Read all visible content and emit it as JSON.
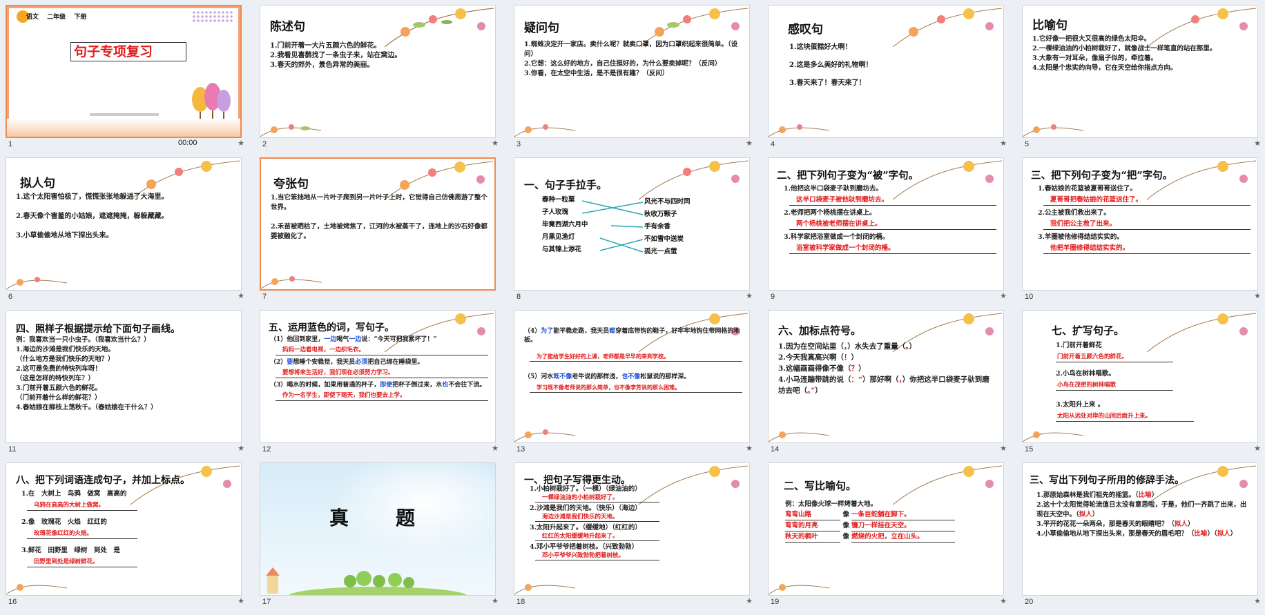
{
  "slides": [
    {
      "num": "1",
      "time": "00:00",
      "header": {
        "subject": "语文",
        "grade": "二年级",
        "term": "下册"
      },
      "title": "句子专项复习"
    },
    {
      "num": "2",
      "title": "陈述句",
      "lines": [
        "1.门前开着一大片五颜六色的鲜花。",
        "2.我看见喜鹊找了一条虫子来，站在窝边。",
        "3.春天的郊外，景色异常的美丽。"
      ]
    },
    {
      "num": "3",
      "title": "疑问句",
      "lines": [
        "1.蜘蛛决定开一家店。卖什么呢？就卖口罩，因为口罩织起来很简单。（设问）",
        "2.它想：这么好的地方，自己住挺好的，为什么要卖掉呢？（反问）",
        "3.你看，在太空中生活，是不是很有趣？（反问）"
      ]
    },
    {
      "num": "4",
      "title": "感叹句",
      "lines": [
        "1.这块蛋糕好大啊！",
        "2.这是多么美好的礼物啊！",
        "3.春天来了！春天来了！"
      ]
    },
    {
      "num": "5",
      "title": "比喻句",
      "lines": [
        "1.它好像一把很大又很高的绿色太阳伞。",
        "2.一棵绿油油的小柏树栽好了，就像战士一样笔直的站在那里。",
        "3.大象有一对耳朵，像扇子似的，牵拉着。",
        "4.太阳是个忠实的向导，它在天空给你指点方向。"
      ]
    },
    {
      "num": "6",
      "title": "拟人句",
      "lines": [
        "1.这个太阳害怕极了，慌慌张张地躲进了大海里。",
        "2.春天像个害羞的小姑娘，遮遮掩掩，躲躲藏藏。",
        "3.小草偷偷地从地下探出头来。"
      ]
    },
    {
      "num": "7",
      "title": "夸张句",
      "lines": [
        "1.当它笨拙地从一片叶子爬到另一片叶子上时，它觉得自己仿佛周游了整个世界。",
        "2.禾苗被晒枯了，土地被烤焦了，江河的水被蒸干了，连地上的沙石好像都要被融化了。"
      ]
    },
    {
      "num": "8",
      "title": "一、句子手拉手。",
      "left": [
        "春种一粒粟",
        "子人玫瑰",
        "毕竟西湖六月中",
        "月黑见渔灯",
        "与其锦上添花"
      ],
      "right": [
        "风光不与四时同",
        "秋收万颗子",
        "手有余香",
        "不如雪中送炭",
        "孤光一点萤"
      ]
    },
    {
      "num": "9",
      "title": "二、把下列句子变为“被”字句。",
      "items": [
        {
          "q": "1.他把这半口袋麦子驮到磨坊去。",
          "a": "这半口袋麦子被他驮到磨坊去。"
        },
        {
          "q": "2.老师把两个杨桃摆在讲桌上。",
          "a": "两个杨桃被老师摆在讲桌上。"
        },
        {
          "q": "3.科学家把浴室做成一个封闭的桶。",
          "a": "浴室被科学家做成一个封闭的桶。"
        }
      ]
    },
    {
      "num": "10",
      "title": "三、把下列句子变为“把”字句。",
      "items": [
        {
          "q": "1.春姑娘的花篮被夏哥哥送住了。",
          "a": "夏哥哥把春姑娘的花篮送住了。"
        },
        {
          "q": "2.公主被我们救出来了。",
          "a": "我们把公主救了出来。"
        },
        {
          "q": "3.羊圈被他修得结结实实的。",
          "a": "他把羊圈修得结结实实的。"
        }
      ]
    },
    {
      "num": "11",
      "title": "四、照样子根据提示给下面句子画线。",
      "lines": [
        "例：我喜欢当一只小虫子。（我喜欢当什么？）",
        "1.海边的沙滩是我们快乐的天地。",
        "（什么地方是我们快乐的天地？）",
        "2.这可是免费的特快列车呀！",
        "（这是怎样的特快列车？）",
        "3.门前开着五颜六色的鲜花。",
        "（门前开着什么样的鲜花？）",
        "4.春姑娘在柳枝上荡秋千。（春姑娘在干什么？）"
      ]
    },
    {
      "num": "12",
      "title": "五、运用蓝色的词，写句子。",
      "items": [
        {
          "q1": "（1）他回到家里，",
          "b1": "一边",
          "q2": "喝气",
          "b2": "一边",
          "q3": "说：“今天可把我累坏了！”",
          "a": "妈妈一边看电视，一边织毛衣。"
        },
        {
          "q1": "（2）",
          "b1": "要",
          "q2": "想睡个安稳觉，我天员",
          "b2": "必须",
          "q3": "把自己绑在睡袋里。",
          "a": "要想将来生活好，我们现在必须努力学习。"
        },
        {
          "q1": "（3）喝水的时候，如果用普通的杯子，",
          "b1": "即使",
          "q2": "把杯子倒过来，水",
          "b2": "也",
          "q3": "不会往下流。",
          "a": "作为一名学生，即使下雨天，我们也要去上学。"
        }
      ]
    },
    {
      "num": "13",
      "items": [
        {
          "q1": "（4）",
          "b1": "为了",
          "q2": "能平稳走路，我天员",
          "b2": "都",
          "q3": "穿着底带钩的鞋子，好牢牢地钩住带网格的地板。",
          "a": "为了能给学生好好的上课，老师都是早早的来到学校。"
        },
        {
          "q1": "（5）河水",
          "b1": "既不像",
          "q2": "老牛说的那样浅，",
          "b2": "也不像",
          "q3": "松鼠说的那样深。",
          "a": "学习既不像老师说的那么简单，也不像李芳说的那么困难。"
        }
      ]
    },
    {
      "num": "14",
      "title": "六、加标点符号。",
      "lines": [
        {
          "t": "1.因为在空间站里",
          "p": "，",
          "t2": "水失去了重量",
          "p2": "。"
        },
        {
          "t": "2.今天我真高兴啊",
          "p": "！"
        },
        {
          "t": "3.这幅画画得像不像",
          "p": "？"
        },
        {
          "t": "4.小马连蹦带跳的说",
          "p": "：“",
          "t2": "那好啊",
          "p2": "，",
          "t3": "你把这半口袋麦子驮到磨坊去吧",
          "p3": "。”"
        }
      ]
    },
    {
      "num": "15",
      "title": "七、扩写句子。",
      "items": [
        {
          "q": "1.门前开着鲜花",
          "a": "门前开着五颜六色的鲜花。"
        },
        {
          "q": "2.小鸟在树林唱歌。",
          "a": "小鸟在茂密的树林唱歌"
        },
        {
          "q": "3.太阳升上来 。",
          "a": "太阳从远处对岸的山间后面升上来。"
        }
      ]
    },
    {
      "num": "16",
      "title": "八、把下列词语连成句子，并加上标点。",
      "items": [
        {
          "q": "1.在　大树上　鸟鸦　做窝　高高的",
          "a": "乌鸦在高高的大树上做窝。"
        },
        {
          "q": "2.像　玫瑰花　火焰　红红的",
          "a": "玫瑰花像红红的火焰。"
        },
        {
          "q": "3.鲜花　田野里　绿树　到处　是",
          "a": "田野里到处是绿树鲜花。"
        }
      ]
    },
    {
      "num": "17",
      "title": "真　　题"
    },
    {
      "num": "18",
      "title": "一、把句子写得更生动。",
      "items": [
        {
          "q": "1.小柏树栽好了。（一棵）（绿油油的）",
          "a": "一棵绿油油的小柏树栽好了。"
        },
        {
          "q": "2.沙滩是我们的天地。（快乐）（海边）",
          "a": "海边沙滩是我们快乐的天地。"
        },
        {
          "q": "3.太阳升起来了。（缓缓地）（红红的）",
          "a": "红红的太阳缓缓地升起来了。"
        },
        {
          "q": "4.邓小平爷爷把着树枝。（兴致勃勃）",
          "a": "邓小平爷爷兴致勃勃把着树枝。"
        }
      ]
    },
    {
      "num": "19",
      "title": "二、写比喻句。",
      "example": "例：太阳像火球一样烤着大地。",
      "items": [
        {
          "l": "弯弯山路",
          "a": "一条巨蛇躺在脚下。"
        },
        {
          "l": "弯弯的月亮",
          "a": "镰刀一样挂在天空。"
        },
        {
          "l": "秋天的枫叶",
          "a": "燃烧的火把，立在山头。"
        }
      ],
      "like": "像"
    },
    {
      "num": "20",
      "title": "三、写出下列句子所用的修辞手法。",
      "lines": [
        {
          "t": "1.那原始森林是我们祖先的摇篮。（",
          "a": "比喻",
          "e": "）"
        },
        {
          "t": "2.这十个太阳觉得轮流值日太没有意思啦，于是，他们一齐跳了出来，出现在天空中。（",
          "a": "拟人",
          "e": "）"
        },
        {
          "t": "3.平开的花花一朵两朵，那是春天的眼睛吧？（",
          "a": "拟人",
          "e": "）"
        },
        {
          "t": "4.小草偷偷地从地下探出头来，那是春天的眉毛吧？（",
          "a": "比喻",
          "e": "）（",
          "a2": "拟人",
          "e2": "）"
        }
      ]
    }
  ]
}
